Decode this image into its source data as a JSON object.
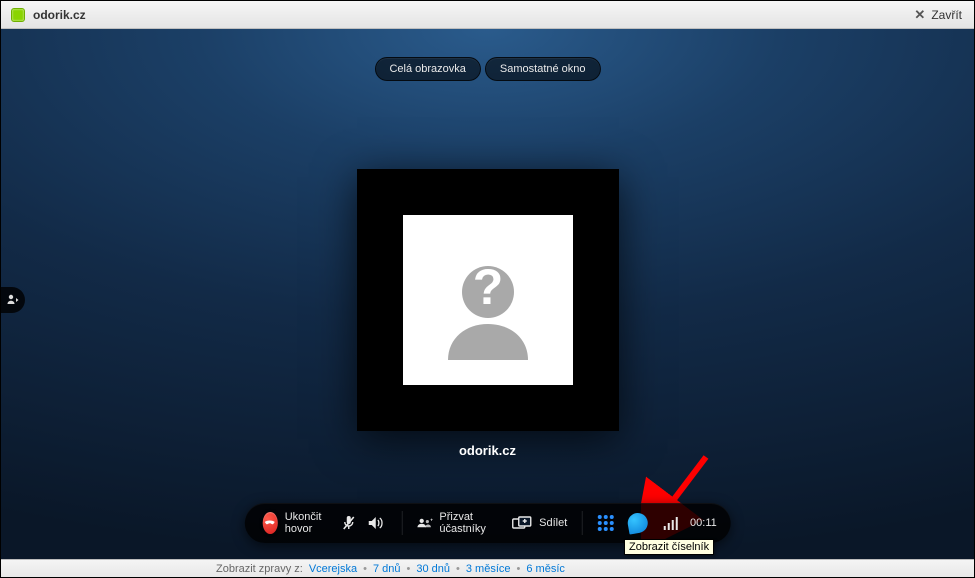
{
  "titlebar": {
    "title": "odorik.cz",
    "close_label": "Zavřít"
  },
  "top_buttons": {
    "fullscreen": "Celá obrazovka",
    "popout": "Samostatné okno"
  },
  "contact": {
    "name": "odorik.cz"
  },
  "toolbar": {
    "hangup_label": "Ukončit hovor",
    "invite_label": "Přizvat účastníky",
    "share_label": "Sdílet",
    "duration": "00:11"
  },
  "tooltip": {
    "dialpad": "Zobrazit číselník"
  },
  "bottom_strip": {
    "label_prefix": "Zobrazit zpravy z:",
    "links": [
      "Vcerejska",
      "7 dnů",
      "30 dnů",
      "3 měsíce",
      "6 měsíc"
    ]
  },
  "icons": {
    "status": "status-online-icon",
    "close": "close-icon",
    "side_tab": "expand-contacts-icon",
    "hangup": "hangup-icon",
    "mic_mute": "microphone-mute-icon",
    "speaker": "speaker-icon",
    "group": "group-add-icon",
    "share": "share-screen-icon",
    "dialpad": "dialpad-icon",
    "balloon": "chat-balloon-icon",
    "signal": "signal-strength-icon"
  }
}
